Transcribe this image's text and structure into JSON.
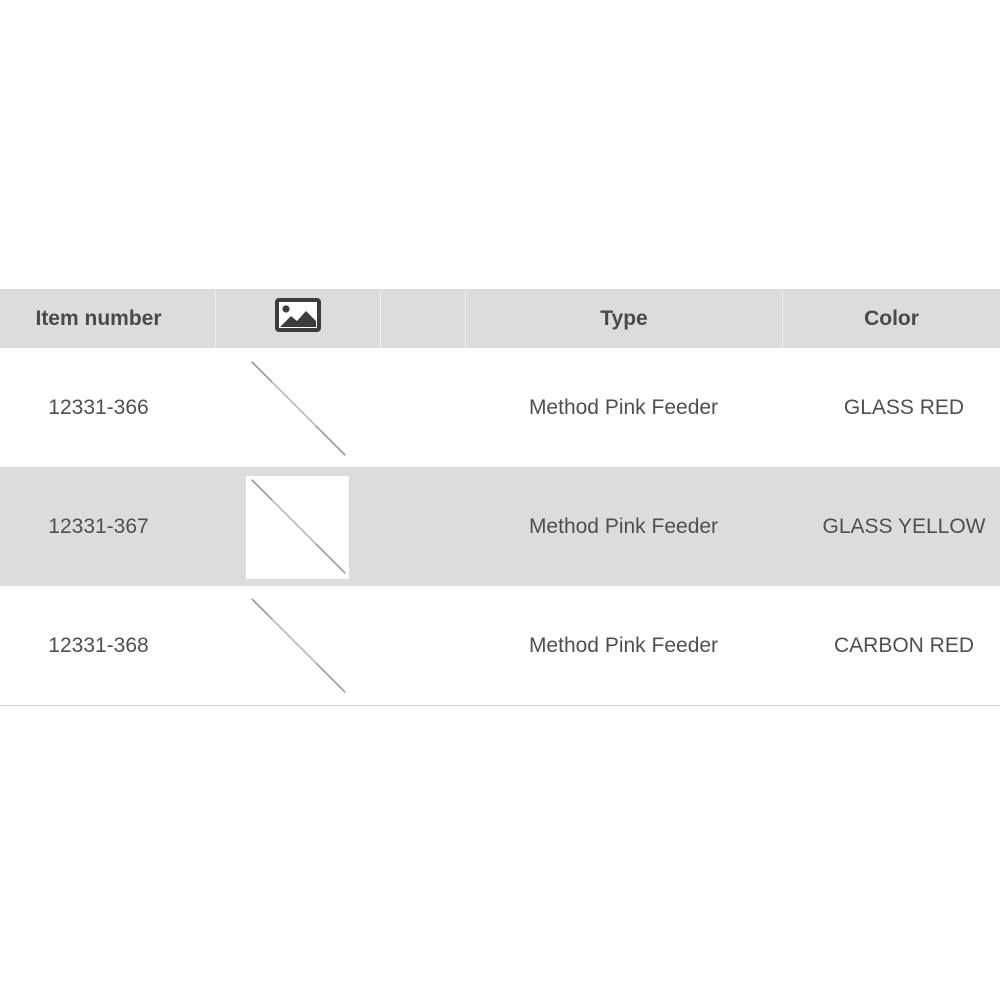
{
  "table": {
    "headers": {
      "item_number": "Item number",
      "image_icon": "image-icon",
      "type": "Type",
      "color": "Color"
    },
    "rows": [
      {
        "item_number": "12331-366",
        "type": "Method Pink Feeder",
        "color": "GLASS RED"
      },
      {
        "item_number": "12331-367",
        "type": "Method Pink Feeder",
        "color": "GLASS YELLOW"
      },
      {
        "item_number": "12331-368",
        "type": "Method Pink Feeder",
        "color": "CARBON RED"
      }
    ]
  },
  "colors": {
    "header_bg": "#dcdcdc",
    "alt_row_bg": "#dcdcdc",
    "text": "#4f4f4f"
  }
}
